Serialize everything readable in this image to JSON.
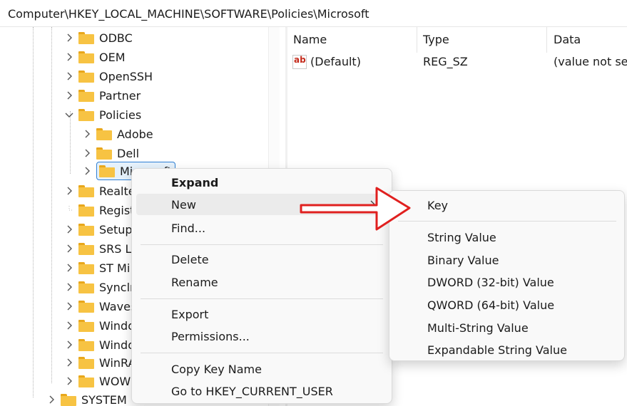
{
  "address": {
    "path": "Computer\\HKEY_LOCAL_MACHINE\\SOFTWARE\\Policies\\Microsoft"
  },
  "tree": {
    "odbc": "ODBC",
    "oem": "OEM",
    "openssh": "OpenSSH",
    "partner": "Partner",
    "policies": "Policies",
    "adobe": "Adobe",
    "dell": "Dell",
    "microsoft": "Microsoft",
    "realtek": "Realte",
    "registered": "Regist",
    "setup": "Setup",
    "srs": "SRS La",
    "stmicro": "ST Mi",
    "synchro": "Syncln",
    "waves": "Waves",
    "windows1": "Windo",
    "windows2": "Windo",
    "winrar": "WinRA",
    "wow": "WOW",
    "system": "SYSTEM"
  },
  "list": {
    "headers": {
      "name": "Name",
      "type": "Type",
      "data": "Data"
    },
    "rows": [
      {
        "name": "(Default)",
        "type": "REG_SZ",
        "data": "(value not set)"
      }
    ]
  },
  "context_menu": {
    "expand": "Expand",
    "new": "New",
    "find": "Find...",
    "delete": "Delete",
    "rename": "Rename",
    "export": "Export",
    "permissions": "Permissions...",
    "copy_key_name": "Copy Key Name",
    "go_to": "Go to HKEY_CURRENT_USER"
  },
  "submenu": {
    "key": "Key",
    "string": "String Value",
    "binary": "Binary Value",
    "dword": "DWORD (32-bit) Value",
    "qword": "QWORD (64-bit) Value",
    "multi": "Multi-String Value",
    "expandable": "Expandable String Value"
  },
  "icons": {
    "folder": "folder-icon",
    "chevron_right": "chevron-right-icon",
    "chevron_down": "chevron-down-icon",
    "string_value": "ab-string-value-icon",
    "arrow": "red-arrow-icon"
  },
  "colors": {
    "folder": "#f7c343",
    "selection": "#e5f1fb",
    "selection_border": "#2f7fd4",
    "arrow": "#e0201f",
    "menu_bg": "#f9f9f9"
  }
}
